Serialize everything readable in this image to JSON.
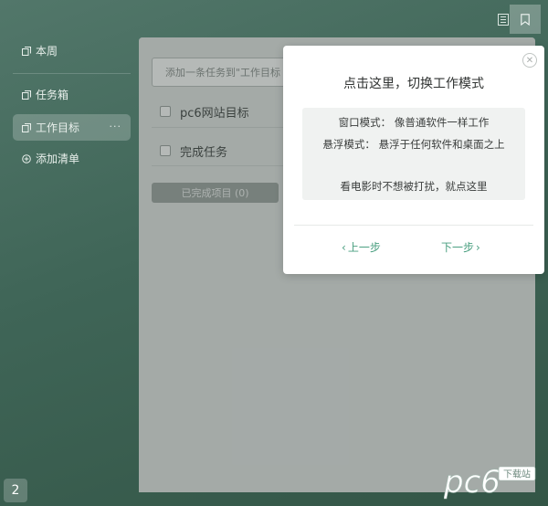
{
  "sidebar": {
    "items": [
      {
        "label": "本周",
        "icon": "copy-icon"
      },
      {
        "label": "任务箱",
        "icon": "copy-icon"
      },
      {
        "label": "工作目标",
        "icon": "copy-icon",
        "more": "···",
        "active": true
      },
      {
        "label": "添加清单",
        "icon": "plus-circle-icon"
      }
    ]
  },
  "badge": "2",
  "main": {
    "input_placeholder": "添加一条任务到\"工作目标",
    "tasks": [
      {
        "label": "pc6网站目标"
      },
      {
        "label": "完成任务"
      }
    ],
    "completed_button": "已完成项目 (0)"
  },
  "popup": {
    "title": "点击这里，切换工作模式",
    "lines": [
      "窗口模式：  像普通软件一样工作",
      "悬浮模式：  悬浮于任何软件和桌面之上",
      "",
      "看电影时不想被打扰，就点这里"
    ],
    "prev_label": "上一步",
    "next_label": "下一步",
    "accent_color": "#4a9f80"
  },
  "watermark": {
    "brand": "pc6",
    "sub": "下载站"
  }
}
